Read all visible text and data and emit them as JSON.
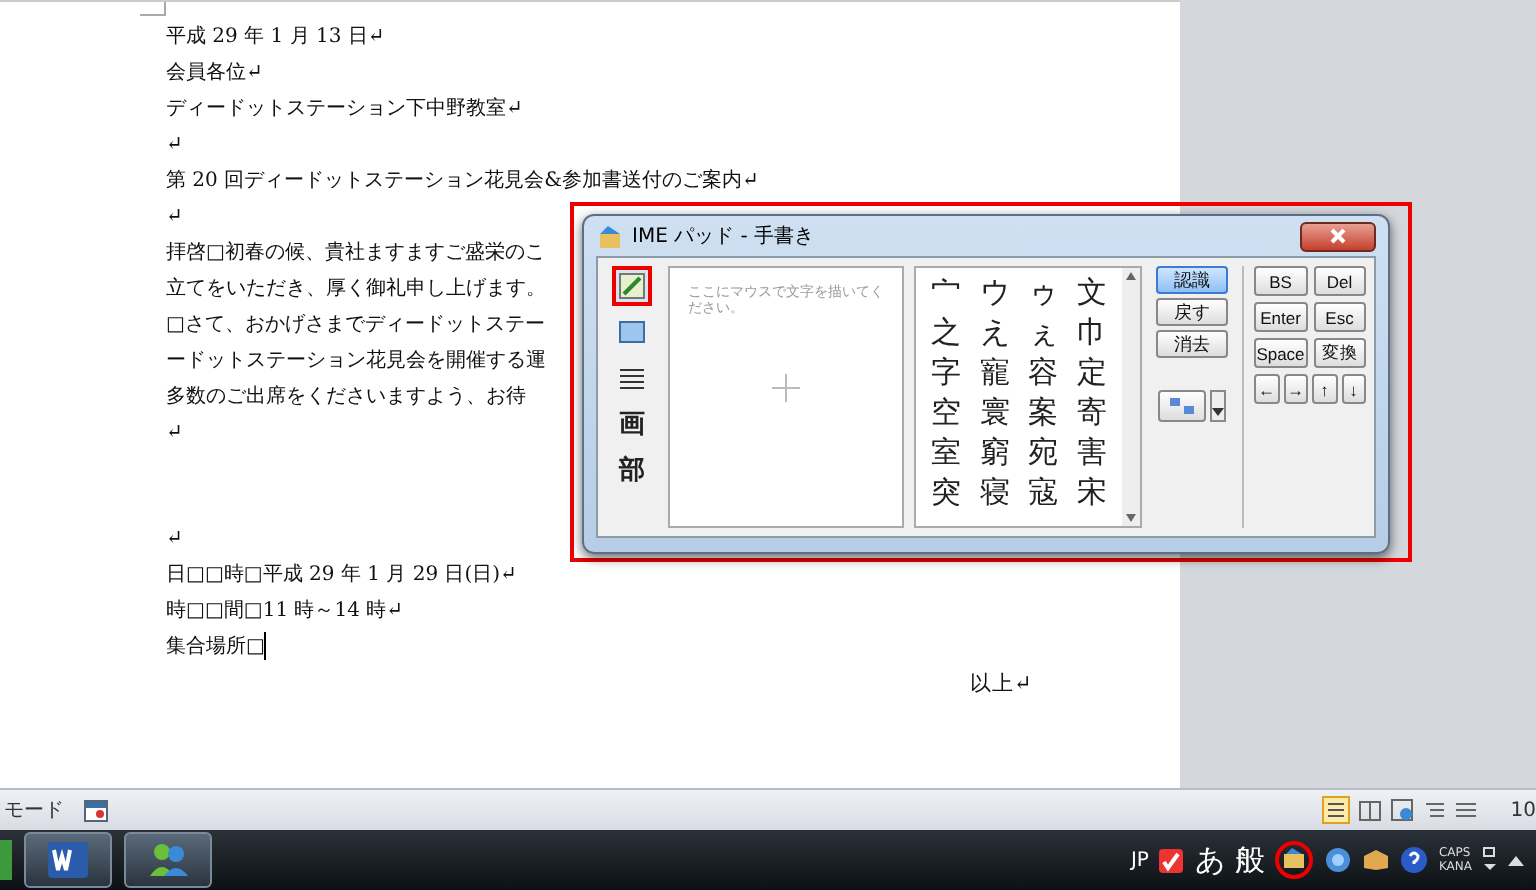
{
  "document": {
    "lines": [
      "平成 29 年 1 月 13 日↵",
      "会員各位↵",
      "ディードットステーション下中野教室↵",
      "↵",
      "第 20 回ディードットステーション花見会&参加書送付のご案内↵",
      "↵",
      "拝啓□初春の候、貴社ますますご盛栄のこ",
      "立てをいただき、厚く御礼申し上げます。",
      "□さて、おかげさまでディードットステー",
      "ードットステーション花見会を開催する運",
      "多数のご出席をくださいますよう、お待",
      "↵"
    ],
    "details": [
      "↵",
      "日□□時□平成 29 年 1 月 29 日(日)↵",
      "時□□間□11 時～14 時↵",
      "集合場所□"
    ],
    "closing": "以上↵"
  },
  "ime_pad": {
    "title": "IME パッド - 手書き",
    "modes": [
      {
        "kind": "pen",
        "selected": true
      },
      {
        "kind": "keyboard",
        "selected": false
      },
      {
        "kind": "strokes",
        "selected": false
      },
      {
        "kind": "char",
        "label": "画",
        "selected": false
      },
      {
        "kind": "radical",
        "label": "部",
        "selected": false
      }
    ],
    "canvas": {
      "placeholder": "ここにマウスで文字を描いてください。"
    },
    "candidates": [
      "宀",
      "ウ",
      "ゥ",
      "文",
      "之",
      "え",
      "ぇ",
      "巾",
      "字",
      "寵",
      "容",
      "定",
      "空",
      "寰",
      "案",
      "寄",
      "室",
      "窮",
      "宛",
      "害",
      "突",
      "寝",
      "寇",
      "宋"
    ],
    "actions": [
      {
        "label": "認識",
        "selected": true
      },
      {
        "label": "戻す",
        "selected": false
      },
      {
        "label": "消去",
        "selected": false
      }
    ],
    "keys": [
      "BS",
      "Del",
      "Enter",
      "Esc",
      "Space",
      "変換",
      "←",
      "→",
      "↑",
      "↓"
    ]
  },
  "status_bar": {
    "mode": "モード",
    "zoom": "10"
  },
  "taskbar": {
    "language": "JP",
    "input_mode": "あ",
    "ime_mode": "般",
    "caps": "CAPS",
    "kana": "KANA"
  }
}
